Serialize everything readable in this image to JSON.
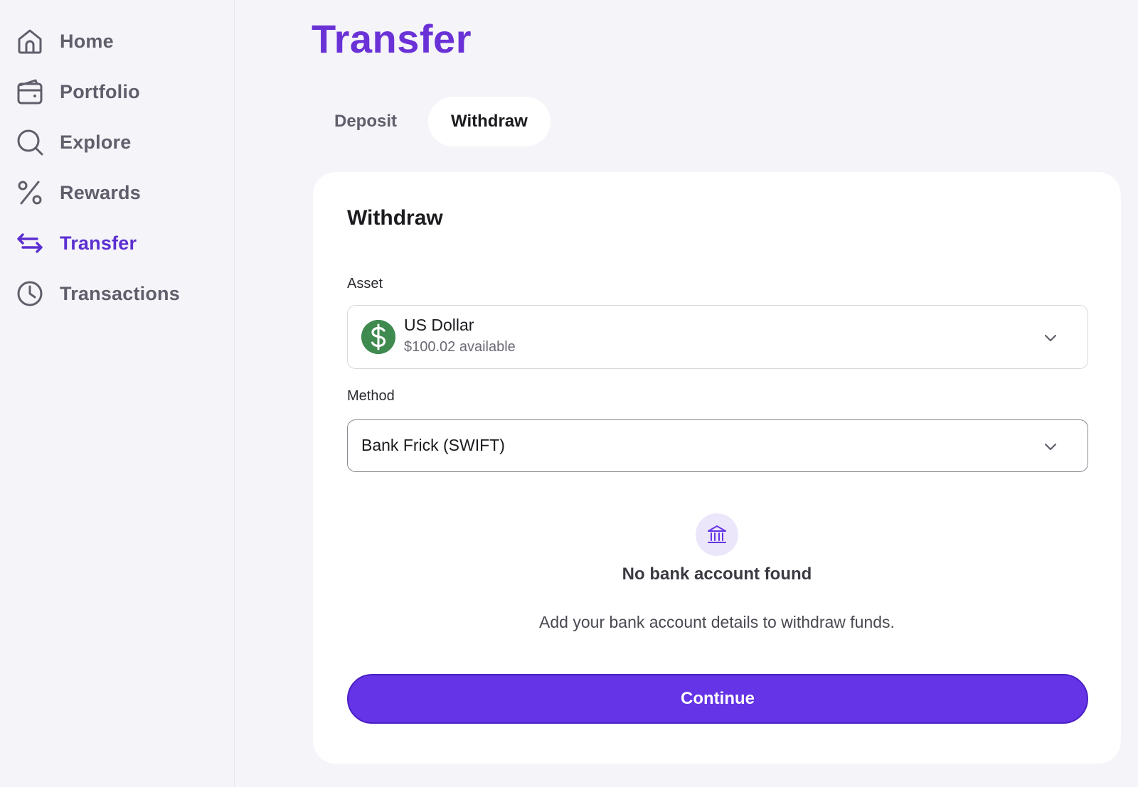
{
  "sidebar": {
    "items": [
      {
        "label": "Home",
        "icon": "home-icon"
      },
      {
        "label": "Portfolio",
        "icon": "wallet-icon"
      },
      {
        "label": "Explore",
        "icon": "search-icon"
      },
      {
        "label": "Rewards",
        "icon": "percent-icon"
      },
      {
        "label": "Transfer",
        "icon": "transfer-arrows-icon",
        "active": true
      },
      {
        "label": "Transactions",
        "icon": "clock-icon"
      }
    ]
  },
  "page": {
    "title": "Transfer"
  },
  "tabs": [
    {
      "label": "Deposit"
    },
    {
      "label": "Withdraw",
      "active": true
    }
  ],
  "withdraw_card": {
    "title": "Withdraw",
    "asset": {
      "label": "Asset",
      "name": "US Dollar",
      "available": "$100.02 available",
      "icon": "dollar-icon"
    },
    "method": {
      "label": "Method",
      "value": "Bank Frick (SWIFT)"
    },
    "empty_state": {
      "icon": "bank-icon",
      "title": "No bank account found",
      "description": "Add your bank account details to withdraw funds."
    },
    "continue_label": "Continue"
  },
  "colors": {
    "accent": "#6434e6",
    "title": "#6a32d6",
    "active_nav": "#5b2fd0",
    "dollar_green": "#3f8a4f",
    "background": "#f5f4f9"
  }
}
